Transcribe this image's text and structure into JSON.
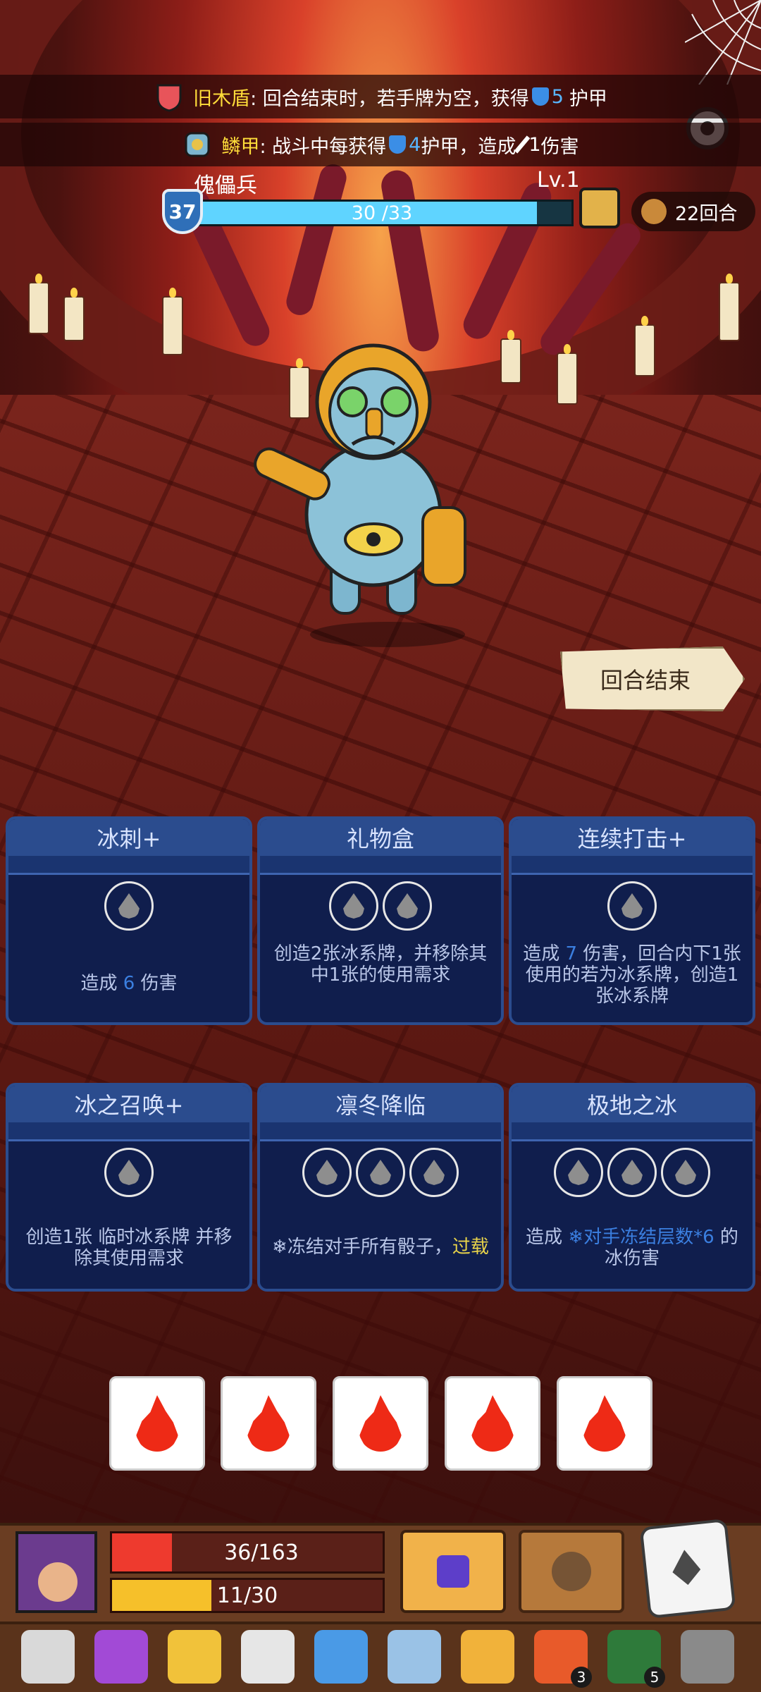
{
  "buffs": [
    {
      "name": "旧木盾",
      "text_before": ": 回合结束时，若手牌为空，获得",
      "value": "5",
      "text_after": "护甲"
    },
    {
      "name": "鳞甲",
      "text_before": ": 战斗中每获得",
      "value": "4",
      "text_mid": "护甲，造成",
      "value2": "1",
      "text_after": "伤害"
    }
  ],
  "enemy": {
    "name": "傀儡兵",
    "level": "Lv.1",
    "armor": "37",
    "hp_text": "30 /33",
    "hp_fraction": 0.909
  },
  "round": {
    "label": "22回合"
  },
  "end_turn": {
    "label": "回合结束"
  },
  "cards": [
    {
      "title": "冰刺+",
      "slots": 1,
      "desc_parts": [
        "造成 ",
        "6",
        " 伤害"
      ]
    },
    {
      "title": "礼物盒",
      "slots": 2,
      "desc": "创造2张冰系牌，并移除其中1张的使用需求"
    },
    {
      "title": "连续打击+",
      "slots": 1,
      "desc_a": "造成 ",
      "desc_b": "7",
      "desc_c": " 伤害，回合内下1张使用的若为",
      "desc_d": "冰系牌，创造1张冰系牌"
    },
    {
      "title": "冰之召唤+",
      "slots": 1,
      "desc_a": "创造1张 临时",
      "desc_b": "冰系牌 并移除其使用需求"
    },
    {
      "title": "凛冬降临",
      "slots": 3,
      "desc_a": "❄冻结对手所有骰子，",
      "desc_b": "过载"
    },
    {
      "title": "极地之冰",
      "slots": 3,
      "desc_a": "造成 ",
      "desc_b": "❄对手冻结层数*6",
      "desc_c": " 的冰伤害"
    }
  ],
  "dice": {
    "count": 5,
    "icon": "fire-icon",
    "color": "#ee2a16"
  },
  "player": {
    "hp_text": "36/163",
    "hp_fraction": 0.221,
    "energy_text": "11/30",
    "energy_fraction": 0.367
  },
  "relics": [
    {
      "name": "scroll-relic-icon"
    },
    {
      "name": "potion-relic-icon"
    },
    {
      "name": "cheese-relic-icon"
    },
    {
      "name": "skull-helmet-relic-icon"
    },
    {
      "name": "crystal-sword-relic-icon"
    },
    {
      "name": "horn-relic-icon"
    },
    {
      "name": "gem-crown-relic-icon"
    },
    {
      "name": "fire-ring-relic-icon",
      "count": "3"
    },
    {
      "name": "green-ring-relic-icon",
      "count": "5"
    },
    {
      "name": "armor-relic-icon"
    }
  ]
}
